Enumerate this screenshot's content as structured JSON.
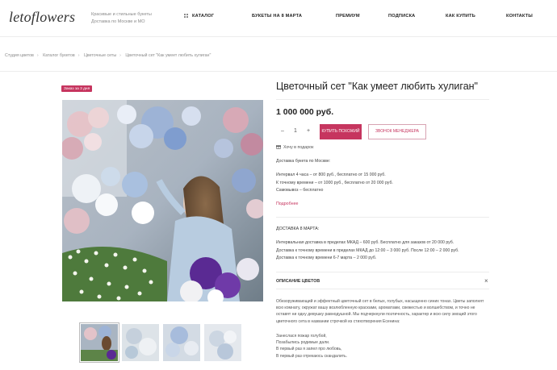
{
  "header": {
    "logo": "letoflowers",
    "tagline": [
      "Красивые и стильные букеты",
      "Доставка по Москве и МО"
    ],
    "nav": [
      {
        "label": "Каталог"
      },
      {
        "label": "Букеты на 8 марта"
      },
      {
        "label": "Премиум"
      },
      {
        "label": "Подписка"
      },
      {
        "label": "Как купить"
      },
      {
        "label": "Контакты"
      }
    ]
  },
  "breadcrumb": [
    "Студия цветов",
    "Каталог букетов",
    "Цветочные сеты",
    "Цветочный сет \"Как умеет любить хулиган\""
  ],
  "gallery": {
    "badge": "Заказ за 3 дня",
    "thumb_count": 4
  },
  "product": {
    "title": "Цветочный сет \"Как умеет любить хулиган\"",
    "price": "1 000 000 руб.",
    "quantity": "1",
    "qty_minus": "–",
    "qty_plus": "+",
    "buy_label": "Купить похожий",
    "call_label": "Звонок менеджера",
    "wishlist_label": "Хочу в подарок"
  },
  "delivery": {
    "heading": "Доставка букета по Москве:",
    "lines": [
      "Интервал 4 часа – от 800 руб., бесплатно от 15 000 руб.",
      "К точному времени – от 1000 руб., бесплатно от 20 000 руб.",
      "Самовывоз – бесплатно"
    ],
    "more_link": "Подробнее"
  },
  "march_delivery": {
    "heading": "ДОСТАВКА 8 МАРТА:",
    "lines": [
      "Интервальная доставка в пределах МКАД – 600 руб. Бесплатно для заказов от 20 000 руб.",
      "Доставка к точному времени в пределах МКАД до 12:00 – 3 000 руб. После 12:00 – 2 000 руб.",
      "Доставка к точному времени 6-7 марта – 2 000 руб."
    ]
  },
  "description": {
    "heading": "Описание цветов",
    "close": "×",
    "text": "Обезоруживающий и эффектный цветочный сет в белых, голубых, насыщенно синих тонах. Цветы заполнят всю комнату, окружат вашу возлюбленную красками, ароматами, свежестью и волшебством, и точно не оставят ни одну девушку равнодушной. Мы подчеркнули поэтичность, характер и всю силу эмоций этого цветочного сета в названии строчкой из стихотворения Есенина:",
    "poem": [
      "Занеслася пожар голубой,",
      "Позабылись родимые дали.",
      "В первый раз я запел про любовь,",
      "В первый раз отрекаюсь скандалить."
    ]
  },
  "colors": {
    "accent": "#c6355f"
  }
}
